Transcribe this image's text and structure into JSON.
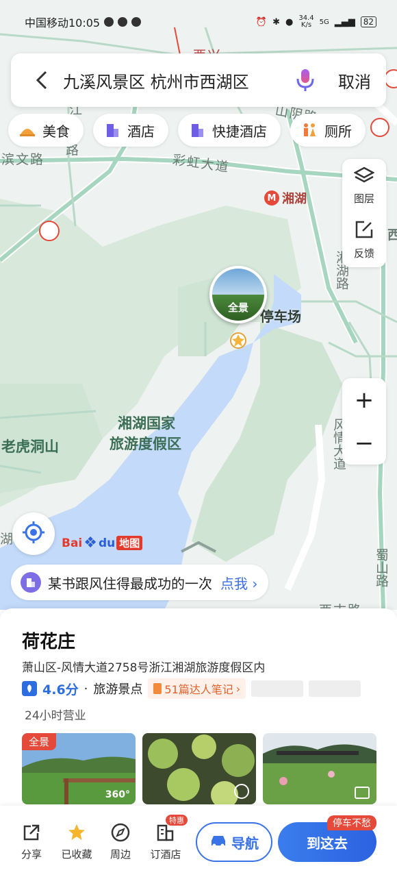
{
  "status_bar": {
    "carrier_time": "中国移动10:05",
    "speed_value": "34.4",
    "speed_unit": "K/s",
    "signal": "5G",
    "battery": "82"
  },
  "search": {
    "query": "九溪风景区 杭州市西湖区",
    "cancel_label": "取消"
  },
  "categories": [
    {
      "label": "美食",
      "icon": "food-icon",
      "color": "#f2a03c"
    },
    {
      "label": "酒店",
      "icon": "hotel-icon",
      "color": "#6e5ee6"
    },
    {
      "label": "快捷酒店",
      "icon": "budget-hotel-icon",
      "color": "#6e5ee6"
    },
    {
      "label": "厕所",
      "icon": "toilet-icon",
      "color": "#f07a3c"
    }
  ],
  "map": {
    "labels": {
      "road_binwen": "滨文路",
      "road_caihong": "彩虹大道",
      "metro_xianghu": "湘湖",
      "road_xianghu": "湘湖路",
      "parking": "停车场",
      "resort_line1": "湘湖国家",
      "resort_line2": "旅游度假区",
      "laohudong": "老虎洞山",
      "road_fengqing": "风情大道",
      "road_shushan": "蜀山路",
      "top_partial": "西兴",
      "shanyin_partial": "山阴路",
      "right_partial": "西",
      "left_partial": "湖",
      "bottom_partial": "西古路",
      "left_road_partial": "江",
      "left_road_partial2": "路"
    },
    "pano_label": "全景",
    "layer_label": "图层",
    "feedback_label": "反馈",
    "zoom_in": "+",
    "zoom_out": "−",
    "logo_text_1": "Bai",
    "logo_text_2": "du",
    "logo_text_3": "地图"
  },
  "tip": {
    "text": "某书跟风住得最成功的一次",
    "link": "点我"
  },
  "poi": {
    "name": "荷花庄",
    "address": "萧山区-风情大道2758号浙江湘湖旅游度假区内",
    "rating": "4.6分",
    "separator": "·",
    "category": "旅游景点",
    "notes": "51篇达人笔记",
    "hours": "24小时营业",
    "photo_badge": "全景",
    "photo_360": "360°"
  },
  "actions": {
    "share": "分享",
    "saved": "已收藏",
    "nearby": "周边",
    "book_hotel": "订酒店",
    "sale_tag": "特惠",
    "navigate": "导航",
    "go_here": "到这去",
    "parking_tag": "停车不愁"
  }
}
